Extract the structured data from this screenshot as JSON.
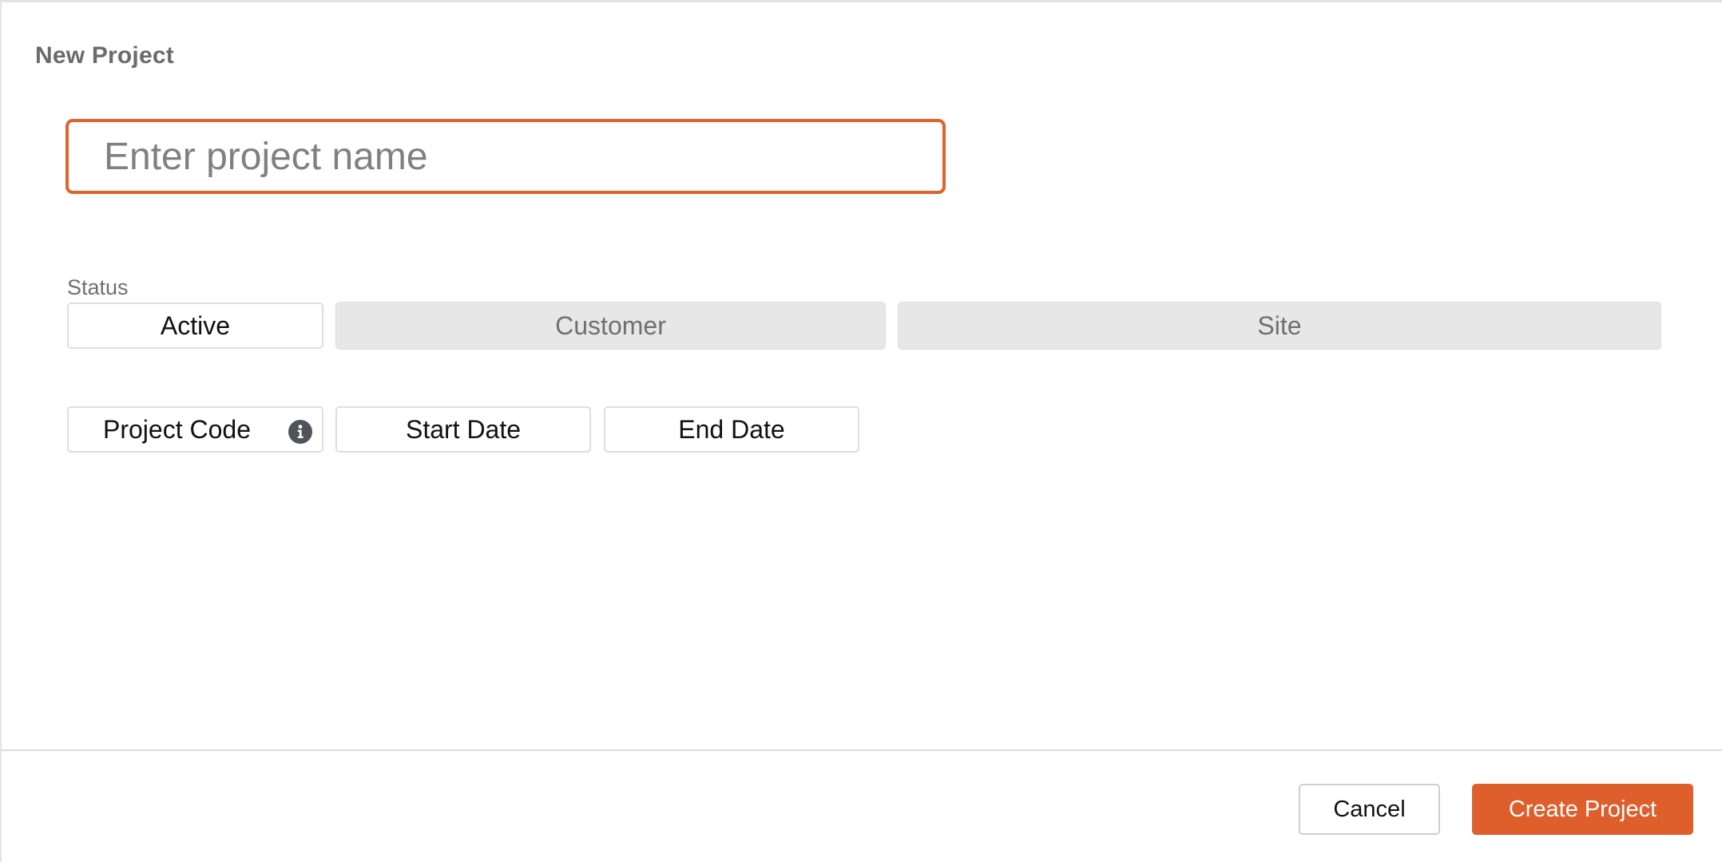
{
  "dialog": {
    "title": "New Project"
  },
  "project_name": {
    "value": "",
    "placeholder": "Enter project name"
  },
  "status": {
    "label": "Status",
    "value": "Active"
  },
  "customer": {
    "label": "Customer"
  },
  "site": {
    "label": "Site"
  },
  "project_code": {
    "label": "Project Code",
    "icon": "info-icon"
  },
  "start_date": {
    "label": "Start Date"
  },
  "end_date": {
    "label": "End Date"
  },
  "footer": {
    "cancel_label": "Cancel",
    "create_label": "Create Project"
  },
  "colors": {
    "accent": "#de5f2c",
    "input_border": "#e0622c",
    "field_disabled_bg": "#e7e7e7",
    "info_icon_bg": "#4e5458"
  }
}
